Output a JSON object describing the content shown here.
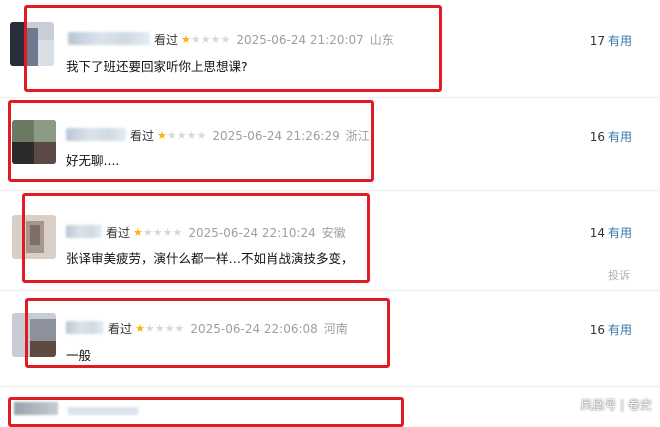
{
  "comments": [
    {
      "seen_label": "看过",
      "stars": [
        1,
        0,
        0,
        0,
        0
      ],
      "time": "2025-06-24 21:20:07",
      "location": "山东",
      "content": "我下了班还要回家听你上思想课?",
      "useful_count": "17",
      "useful_label": "有用"
    },
    {
      "seen_label": "看过",
      "stars": [
        1,
        0,
        0,
        0,
        0
      ],
      "time": "2025-06-24 21:26:29",
      "location": "浙江",
      "content": "好无聊....",
      "useful_count": "16",
      "useful_label": "有用"
    },
    {
      "seen_label": "看过",
      "stars": [
        1,
        0,
        0,
        0,
        0
      ],
      "time": "2025-06-24 22:10:24",
      "location": "安徽",
      "content": "张译审美疲劳，演什么都一样…不如肖战演技多变，",
      "useful_count": "14",
      "useful_label": "有用",
      "report_label": "投诉"
    },
    {
      "seen_label": "看过",
      "stars": [
        1,
        0,
        0,
        0,
        0
      ],
      "time": "2025-06-24 22:06:08",
      "location": "河南",
      "content": "一般",
      "useful_count": "16",
      "useful_label": "有用"
    }
  ],
  "watermark": "凤凰号 | 卷史",
  "colors": {
    "highlight_frame": "#e01b24",
    "star_on": "#f7b500",
    "star_off": "#d8d8d8",
    "useful_link": "#3377aa"
  }
}
